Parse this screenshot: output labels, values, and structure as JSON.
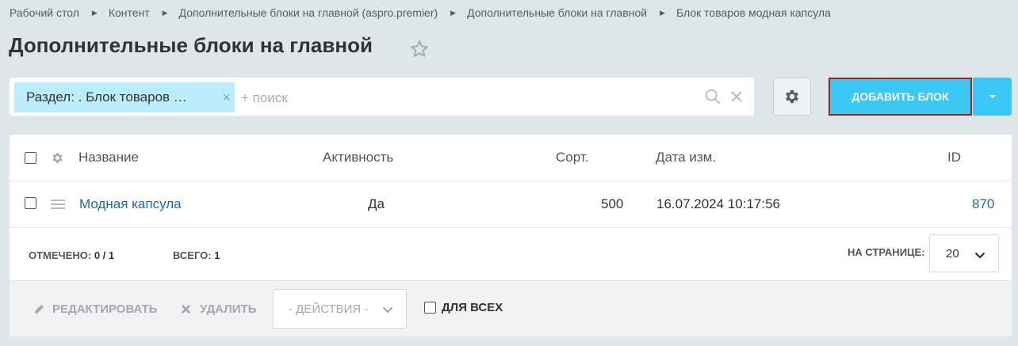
{
  "breadcrumb": [
    {
      "label": "Рабочий стол"
    },
    {
      "label": "Контент"
    },
    {
      "label": "Дополнительные блоки на главной (aspro.premier)"
    },
    {
      "label": "Дополнительные блоки на главной"
    },
    {
      "label": "Блок товаров модная капсула"
    }
  ],
  "page": {
    "title": "Дополнительные блоки на главной"
  },
  "filter": {
    "chip_label": "Раздел: . Блок товаров …",
    "search_placeholder": "+ поиск"
  },
  "toolbar": {
    "add_label": "ДОБАВИТЬ БЛОК"
  },
  "grid": {
    "columns": {
      "name": "Название",
      "active": "Активность",
      "sort": "Сорт.",
      "date": "Дата изм.",
      "id": "ID"
    },
    "rows": [
      {
        "name": "Модная капсула",
        "active": "Да",
        "sort": "500",
        "date": "16.07.2024 10:17:56",
        "id": "870"
      }
    ]
  },
  "footer": {
    "checked_label": "ОТМЕЧЕНО:",
    "checked_value": "0 / 1",
    "total_label": "ВСЕГО:",
    "total_value": "1",
    "per_page_label": "НА СТРАНИЦЕ:",
    "per_page_value": "20"
  },
  "actions": {
    "edit_label": "РЕДАКТИРОВАТЬ",
    "delete_label": "УДАЛИТЬ",
    "select_label": "- ДЕЙСТВИЯ -",
    "for_all_label": "ДЛЯ ВСЕХ"
  },
  "colors": {
    "accent": "#3bc8f5",
    "chip": "#bcedfc",
    "link": "#2067b0",
    "highlight_border": "#b01b1b"
  }
}
